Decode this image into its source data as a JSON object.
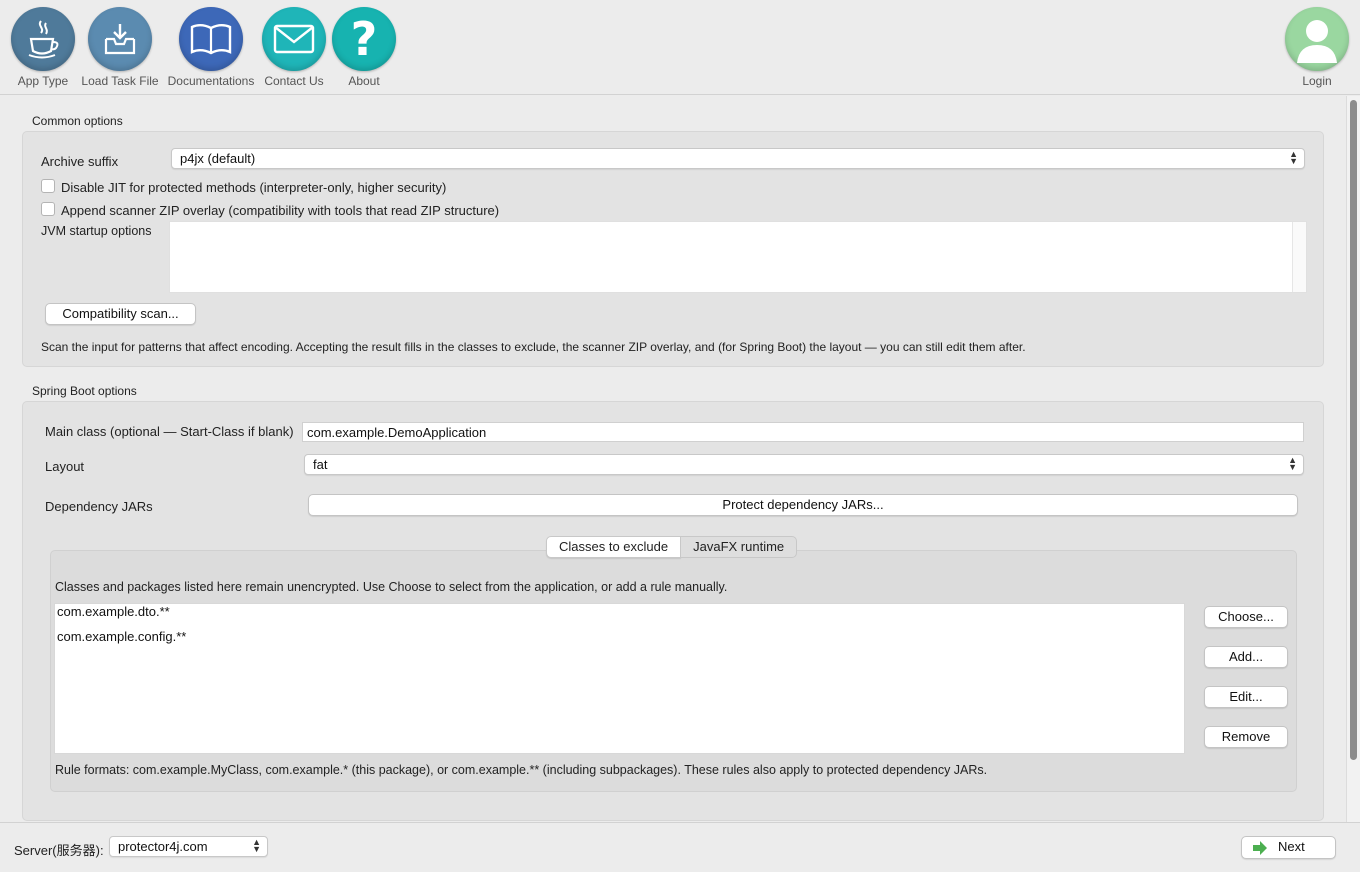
{
  "toolbar": {
    "items": [
      {
        "label": "App Type",
        "icon": "java-cup-icon",
        "color": "#4f7a9a"
      },
      {
        "label": "Load Task File",
        "icon": "inbox-tray-icon",
        "color": "#5b8bb0"
      },
      {
        "label": "Documentations",
        "icon": "book-icon",
        "color": "#3d68b8"
      },
      {
        "label": "Contact Us",
        "icon": "envelope-icon",
        "color": "#1fb5b8"
      },
      {
        "label": "About",
        "icon": "question-icon",
        "color": "#17b3b0"
      }
    ],
    "login": {
      "label": "Login",
      "icon": "user-avatar-icon",
      "color": "#9ad7a0"
    }
  },
  "common": {
    "title": "Common options",
    "archive_suffix_label": "Archive suffix",
    "archive_suffix_value": "p4jx (default)",
    "disable_jit_label": "Disable JIT for protected methods (interpreter-only, higher security)",
    "disable_jit_checked": false,
    "append_zip_label": "Append scanner ZIP overlay (compatibility with tools that read ZIP structure)",
    "append_zip_checked": false,
    "jvm_label": "JVM startup options",
    "jvm_value": "",
    "scan_button": "Compatibility scan...",
    "scan_help": "Scan the input for patterns that affect encoding. Accepting the result fills in the classes to exclude, the scanner ZIP overlay, and (for Spring Boot) the layout — you can still edit them after."
  },
  "spring": {
    "title": "Spring Boot options",
    "main_class_label": "Main class (optional — Start-Class if blank)",
    "main_class_value": "com.example.DemoApplication",
    "layout_label": "Layout",
    "layout_value": "fat",
    "dep_label": "Dependency JARs",
    "dep_button": "Protect dependency JARs...",
    "tabs": [
      "Classes to exclude",
      "JavaFX runtime"
    ],
    "exclude_help": "Classes and packages listed here remain unencrypted. Use Choose to select from the application, or add a rule manually.",
    "exclude_list": [
      "com.example.dto.**",
      "com.example.config.**"
    ],
    "buttons": {
      "choose": "Choose...",
      "add": "Add...",
      "edit": "Edit...",
      "remove": "Remove"
    },
    "rule_help": "Rule formats: com.example.MyClass, com.example.* (this package), or com.example.** (including subpackages). These rules also apply to protected dependency JARs."
  },
  "status": {
    "server_label": "Server(服务器):",
    "server_value": "protector4j.com",
    "next_label": "Next",
    "next_icon_color": "#4caf50"
  }
}
